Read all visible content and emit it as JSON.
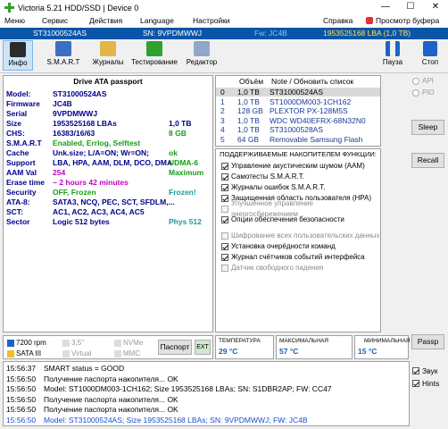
{
  "window": {
    "title": "Victoria 5.21 HDD/SSD | Device 0",
    "min": "—",
    "max": "☐",
    "close": "✕"
  },
  "menu": [
    "Меню",
    "Сервис",
    "Действия",
    "Language",
    "Настройки",
    "Справка"
  ],
  "menu_right": "Просмотр буфера",
  "strip": {
    "model": "ST31000524AS",
    "sn": "SN: 9VPDMWWJ",
    "fw": "Fw: JC4B",
    "size": "1953525168 LBA (1,0 TB)"
  },
  "toolbar": {
    "info": "Инфо",
    "smart": "S.M.A.R.T",
    "journals": "Журналы",
    "testing": "Тестирование",
    "editor": "Редактор",
    "pause": "Пауза",
    "stop": "Стоп"
  },
  "info": {
    "header": "Drive ATA passport",
    "rows": [
      {
        "k": "Model:",
        "v": "ST31000524AS",
        "e": "",
        "vc": "#00008b",
        "ec": ""
      },
      {
        "k": "Firmware",
        "v": "JC4B",
        "e": "",
        "vc": "#00008b",
        "ec": ""
      },
      {
        "k": "Serial",
        "v": "9VPDMWWJ",
        "e": "",
        "vc": "#00008b",
        "ec": ""
      },
      {
        "k": "Size",
        "v": "1953525168 LBAs",
        "e": "1,0 TB",
        "vc": "#00008b",
        "ec": "#00008b"
      },
      {
        "k": "CHS:",
        "v": "16383/16/63",
        "e": "8 GB",
        "vc": "#00008b",
        "ec": "#1a9a1a"
      },
      {
        "k": "S.M.A.R.T",
        "v": "Enabled, Errlog, Selftest",
        "e": "",
        "vc": "#1a9a1a",
        "ec": ""
      },
      {
        "k": "Cache",
        "v": "Unk.size; L/A=ON; Wr=ON;",
        "e": "ok",
        "vc": "#00008b",
        "ec": "#1a9a1a"
      },
      {
        "k": "Support",
        "v": "LBA, HPA, AAM, DLM, DCO, DMA",
        "e": "UDMA-6",
        "vc": "#00008b",
        "ec": "#1a9a1a"
      },
      {
        "k": "AAM Val",
        "v": "254",
        "e": "Maximum",
        "vc": "#c000c0",
        "ec": "#1a9a1a"
      },
      {
        "k": "Erase time",
        "v": "~ 2 hours 42 minutes",
        "e": "",
        "vc": "#c000c0",
        "ec": ""
      },
      {
        "k": "Security",
        "v": "OFF, Frozen",
        "e": "Frozen!",
        "vc": "#1a9a1a",
        "ec": "#1a9a9a"
      },
      {
        "k": "ATA-8:",
        "v": "SATA3, NCQ, PEC, SCT, SFDLM,...",
        "e": "",
        "vc": "#00008b",
        "ec": ""
      },
      {
        "k": "SCT:",
        "v": "AC1, AC2, AC3, AC4, AC5",
        "e": "",
        "vc": "#00008b",
        "ec": ""
      },
      {
        "k": "Sector",
        "v": "Logic 512 bytes",
        "e": "Phys 512",
        "vc": "#00008b",
        "ec": "#1a9a9a"
      }
    ]
  },
  "drives": {
    "header_size": "Объём",
    "header_note": "Note / Обновить список",
    "rows": [
      {
        "n": "0",
        "size": "1,0 TB",
        "name": "ST31000524AS",
        "selected": true
      },
      {
        "n": "1",
        "size": "1,0 TB",
        "name": "ST1000DM003-1CH162",
        "selected": false
      },
      {
        "n": "2",
        "size": "128 GB",
        "name": "PLEXTOR PX-128M5S",
        "selected": false
      },
      {
        "n": "3",
        "size": "1,0 TB",
        "name": "WDC WD40EFRX-68N32N0",
        "selected": false
      },
      {
        "n": "4",
        "size": "1,0 TB",
        "name": "ST31000528AS",
        "selected": false
      },
      {
        "n": "5",
        "size": "64 GB",
        "name": "Removable Samsung Flash Drive",
        "selected": false
      }
    ]
  },
  "features": {
    "header": "ПОДДЕРЖИВАЕМЫЕ НАКОПИТЕЛЕМ ФУНКЦИИ:",
    "items": [
      {
        "label": "Управление акустическим шумом (AAM)",
        "checked": true,
        "disabled": false
      },
      {
        "label": "Самотесты S.M.A.R.T.",
        "checked": true,
        "disabled": false
      },
      {
        "label": "Журналы ошибок S.M.A.R.T.",
        "checked": true,
        "disabled": false
      },
      {
        "label": "Защищенная область пользователя (HPA)",
        "checked": true,
        "disabled": false
      },
      {
        "label": "Улучшенное управление энергосбережением",
        "checked": false,
        "disabled": true
      },
      {
        "label": "Опции обеспечения безопасности",
        "checked": true,
        "disabled": false
      },
      {
        "label": "Шифрование всех пользовательских данных",
        "checked": false,
        "disabled": true
      },
      {
        "label": "Установка очерёдности команд",
        "checked": true,
        "disabled": false
      },
      {
        "label": "Журнал счётчиков событий интерфейса",
        "checked": true,
        "disabled": false
      },
      {
        "label": "Датчик свободного падения",
        "checked": false,
        "disabled": true
      }
    ]
  },
  "side": {
    "api": "API",
    "pio": "PIO",
    "sleep": "Sleep",
    "recall": "Recall",
    "passp": "Passp",
    "sound": "Звук",
    "hints": "Hints"
  },
  "drive_info": {
    "rpm": "7200 rpm",
    "size35": "3,5\"",
    "nvme": "NVMe",
    "sata": "SATA III",
    "virtual": "Virtual",
    "mmc": "MMC",
    "passport_btn": "Паспорт",
    "ext_btn": "EXT"
  },
  "temps": [
    {
      "label": "ТЕМПЕРАТУРА",
      "value": "29 °C"
    },
    {
      "label": "МАКСИМАЛЬНАЯ",
      "value": "57 °C"
    },
    {
      "label": "МИНИМАЛЬНАЯ",
      "value": "15 °C"
    }
  ],
  "log": [
    {
      "t": "15:56:37",
      "m": "SMART status = GOOD",
      "c": "#000"
    },
    {
      "t": "15:56:50",
      "m": "Получение паспорта накопителя... OK",
      "c": "#000"
    },
    {
      "t": "15:56:50",
      "m": "Model: ST1000DM003-1CH162; Size 1953525168 LBAs; SN: S1DBR2AP; FW: CC47",
      "c": "#000"
    },
    {
      "t": "15:56:50",
      "m": "Получение паспорта накопителя... OK",
      "c": "#000"
    },
    {
      "t": "15:56:50",
      "m": "Получение паспорта накопителя... OK",
      "c": "#000"
    },
    {
      "t": "15:56:50",
      "m": "Model: ST31000524AS; Size 1953525168 LBAs; SN: 9VPDMWWJ; FW: JC4B",
      "c": "#1a4fd0"
    }
  ],
  "colors": {
    "accent": "#0b55a8",
    "select": "#d9d9d9"
  }
}
